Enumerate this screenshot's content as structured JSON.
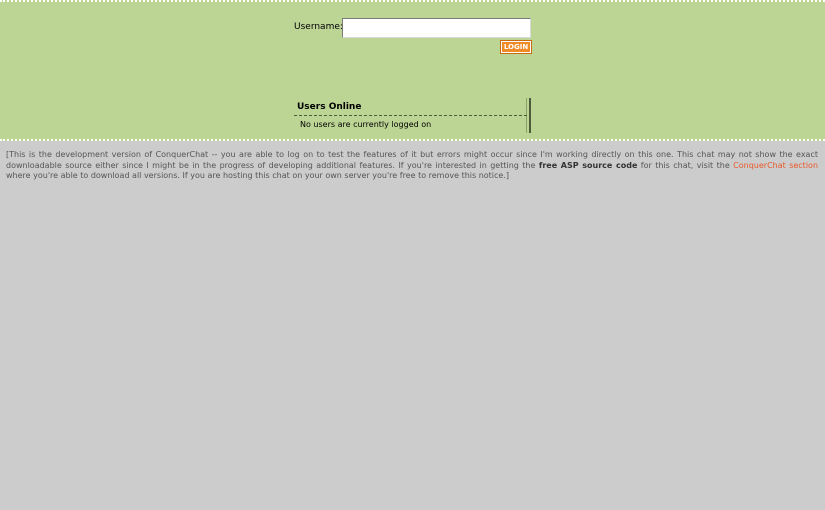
{
  "login": {
    "username_label": "Username:",
    "username_value": "",
    "button_label": "LOGIN"
  },
  "users_online": {
    "title": "Users Online",
    "empty_message": "No users are currently logged on"
  },
  "notice": {
    "part1": "[This is the development version of ConquerChat -- you are able to log on to test the features of it but errors might occur since I'm working directly on this one. This chat may not show the exact downloadable source either since I might be in the progress of developing additional features. If you're interested in getting the ",
    "bold_text": "free ASP source code",
    "part2": " for this chat, visit the ",
    "link_text": "ConquerChat section",
    "part3": " where you're able to download all versions. If you are hosting this chat on your own server you're free to remove this notice.]"
  },
  "colors": {
    "top_panel": "#bcd595",
    "page_background": "#cccccc",
    "login_button": "#f08a25",
    "link": "#e8582a"
  }
}
